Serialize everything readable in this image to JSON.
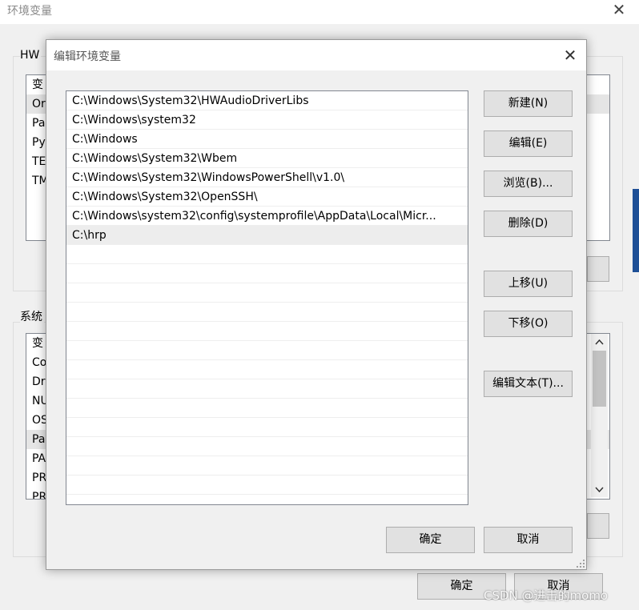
{
  "background_window": {
    "title": "环境变量",
    "close_glyph": "✕",
    "user_group_label": "HW",
    "user_list": [
      "变",
      "Or",
      "Pa",
      "Py",
      "TE",
      "TM"
    ],
    "system_group_label": "系统",
    "system_list": [
      "变",
      "Co",
      "Dr",
      "NU",
      "OS",
      "Pa",
      "PA",
      "PR",
      "PR"
    ],
    "ok_button": "确定",
    "cancel_button": "取消"
  },
  "dialog": {
    "title": "编辑环境变量",
    "close_glyph": "✕",
    "paths": [
      "C:\\Windows\\System32\\HWAudioDriverLibs",
      "C:\\Windows\\system32",
      "C:\\Windows",
      "C:\\Windows\\System32\\Wbem",
      "C:\\Windows\\System32\\WindowsPowerShell\\v1.0\\",
      "C:\\Windows\\System32\\OpenSSH\\",
      "C:\\Windows\\system32\\config\\systemprofile\\AppData\\Local\\Micr...",
      "C:\\hrp"
    ],
    "selected_index": 7,
    "buttons": {
      "new": "新建(N)",
      "edit": "编辑(E)",
      "browse": "浏览(B)...",
      "delete": "删除(D)",
      "move_up": "上移(U)",
      "move_down": "下移(O)",
      "edit_text": "编辑文本(T)..."
    },
    "ok_button": "确定",
    "cancel_button": "取消"
  },
  "watermark": "CSDN @进击的momo",
  "colors": {
    "dialog_bg": "#f0f0f0",
    "button_bg": "#e1e1e1",
    "button_border": "#adadad",
    "selection": "#ededed",
    "accent_edge": "#1e4f96"
  }
}
